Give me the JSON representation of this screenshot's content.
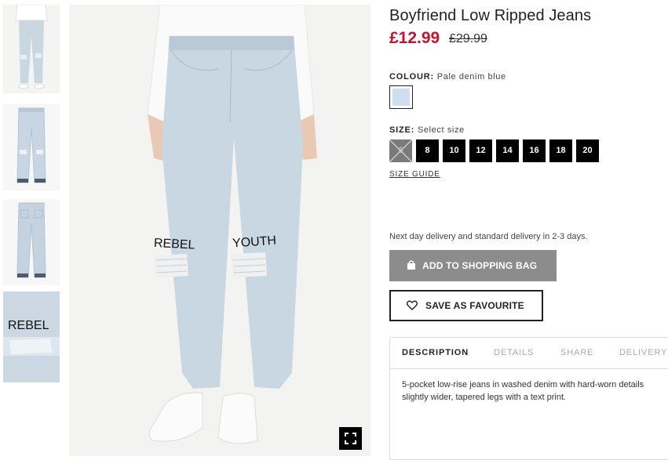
{
  "product": {
    "title": "Boyfriend Low Ripped Jeans",
    "price": "£12.99",
    "old_price": "£29.99"
  },
  "colour": {
    "label": "COLOUR:",
    "value": "Pale denim blue",
    "swatch_color": "#cfdff0"
  },
  "size": {
    "label": "SIZE:",
    "value": "Select size",
    "options": [
      {
        "label": "6",
        "available": false
      },
      {
        "label": "8",
        "available": true
      },
      {
        "label": "10",
        "available": true
      },
      {
        "label": "12",
        "available": true
      },
      {
        "label": "14",
        "available": true
      },
      {
        "label": "16",
        "available": true
      },
      {
        "label": "18",
        "available": true
      },
      {
        "label": "20",
        "available": true
      }
    ],
    "guide_label": "SIZE GUIDE"
  },
  "delivery_text": "Next day delivery and standard delivery in 2-3 days.",
  "buttons": {
    "add_to_bag": "ADD TO SHOPPING BAG",
    "save_favourite": "SAVE AS FAVOURITE"
  },
  "tabs": [
    "DESCRIPTION",
    "DETAILS",
    "SHARE",
    "DELIVERY"
  ],
  "active_tab": "DESCRIPTION",
  "description": [
    "5-pocket low-rise jeans in washed denim with hard-worn details",
    "slightly wider, tapered legs with a text print."
  ],
  "image_prints": {
    "left_knee": "REBEL",
    "right_knee": "YOUTH",
    "thumb_detail": "REBEL"
  },
  "colors": {
    "price_red": "#c41230",
    "button_grey": "#8c8c8c",
    "denim": "#c9d7e3"
  },
  "icons": {
    "fullscreen": "fullscreen-icon",
    "bag": "shopping-bag-icon",
    "heart": "heart-icon"
  }
}
